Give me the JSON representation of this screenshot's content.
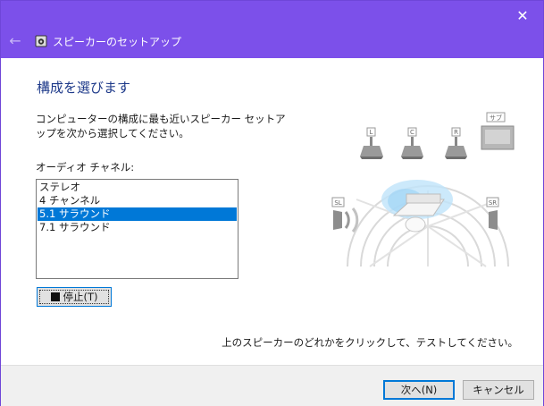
{
  "window": {
    "title": "スピーカーのセットアップ",
    "close_glyph": "✕",
    "back_glyph": "←"
  },
  "main": {
    "heading": "構成を選びます",
    "description": "コンピューターの構成に最も近いスピーカー セットアップを次から選択してください。",
    "channels_label": "オーディオ チャネル:",
    "channels": [
      "ステレオ",
      "4 チャンネル",
      "5.1 サラウンド",
      "7.1 サラウンド"
    ],
    "selected_channel": "5.1 サラウンド",
    "stop_button": "停止(T)",
    "hint": "上のスピーカーのどれかをクリックして、テストしてください。"
  },
  "speakers": {
    "left": "L",
    "center": "C",
    "right": "R",
    "sub": "サブ",
    "surround_left": "SL",
    "surround_right": "SR"
  },
  "footer": {
    "next_button": "次へ(N)",
    "cancel_button": "キャンセル"
  },
  "colors": {
    "titlebar": "#7c50ea",
    "accent": "#0078d7",
    "heading": "#1e3a8a"
  }
}
